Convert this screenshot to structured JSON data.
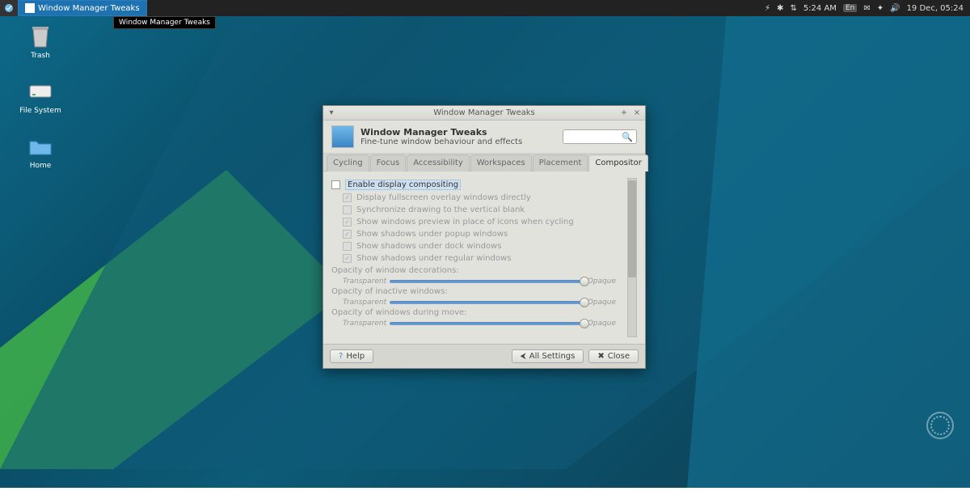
{
  "panel": {
    "taskbar_label": "Window Manager Tweaks",
    "tooltip": "Window Manager Tweaks",
    "time": "5:24 AM",
    "lang": "En",
    "date": "19 Dec, 05:24"
  },
  "desktop_icons": {
    "trash": "Trash",
    "filesystem": "File System",
    "home": "Home"
  },
  "dialog": {
    "title": "Window Manager Tweaks",
    "header_title": "Window Manager Tweaks",
    "header_subtitle": "Fine-tune window behaviour and effects",
    "tabs": [
      "Cycling",
      "Focus",
      "Accessibility",
      "Workspaces",
      "Placement",
      "Compositor"
    ],
    "active_tab": 5,
    "compositor": {
      "enable": "Enable display compositing",
      "enable_checked": false,
      "checks": [
        {
          "label": "Display fullscreen overlay windows directly",
          "checked": true
        },
        {
          "label": "Synchronize drawing to the vertical blank",
          "checked": false
        },
        {
          "label": "Show windows preview in place of icons when cycling",
          "checked": true
        },
        {
          "label": "Show shadows under popup windows",
          "checked": true
        },
        {
          "label": "Show shadows under dock windows",
          "checked": false
        },
        {
          "label": "Show shadows under regular windows",
          "checked": true
        }
      ],
      "sliders": [
        {
          "label": "Opacity of window decorations:",
          "left": "Transparent",
          "right": "Opaque",
          "value": 1.0
        },
        {
          "label": "Opacity of inactive windows:",
          "left": "Transparent",
          "right": "Opaque",
          "value": 1.0
        },
        {
          "label": "Opacity of windows during move:",
          "left": "Transparent",
          "right": "Opaque",
          "value": 1.0
        }
      ]
    },
    "footer": {
      "help": "Help",
      "all_settings": "All Settings",
      "close": "Close"
    }
  }
}
